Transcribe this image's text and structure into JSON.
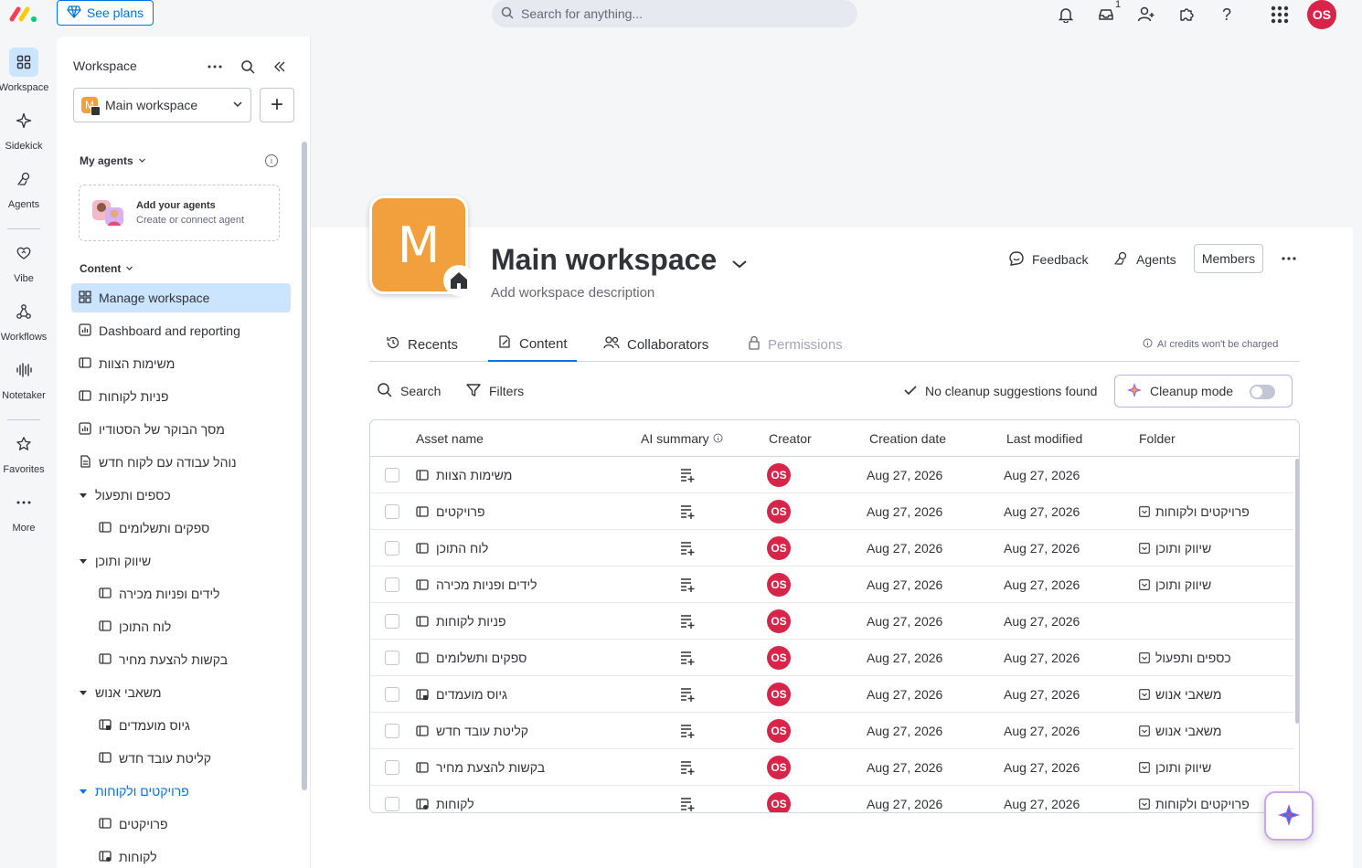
{
  "topbar": {
    "see_plans": "See plans",
    "search_placeholder": "Search for anything...",
    "inbox_count": "1",
    "user_initials": "OS"
  },
  "rail": {
    "workspace": "Workspace",
    "sidekick": "Sidekick",
    "agents": "Agents",
    "vibe": "Vibe",
    "workflows": "Workflows",
    "notetaker": "Notetaker",
    "favorites": "Favorites",
    "more": "More"
  },
  "sidebar": {
    "title": "Workspace",
    "workspace_select": "Main workspace",
    "my_agents_label": "My agents",
    "agent_card_title": "Add your agents",
    "agent_card_subtitle": "Create or connect agent",
    "content_label": "Content",
    "items": [
      {
        "label": "Manage workspace"
      },
      {
        "label": "Dashboard and reporting"
      },
      {
        "label": "משימות הצוות"
      },
      {
        "label": "פניות לקוחות"
      },
      {
        "label": "מסך הבוקר של הסטודיו"
      },
      {
        "label": "נוהל עבודה עם לקוח חדש"
      },
      {
        "label": "כספים ותפעול"
      },
      {
        "label": "ספקים ותשלומים"
      },
      {
        "label": "שיווק ותוכן"
      },
      {
        "label": "לידים ופניות מכירה"
      },
      {
        "label": "לוח התוכן"
      },
      {
        "label": "בקשות להצעת מחיר"
      },
      {
        "label": "משאבי אנוש"
      },
      {
        "label": "גיוס מועמדים"
      },
      {
        "label": "קליטת עובד חדש"
      },
      {
        "label": "פרויקטים ולקוחות"
      },
      {
        "label": "פרויקטים"
      },
      {
        "label": "לקוחות"
      }
    ]
  },
  "header": {
    "avatar_letter": "M",
    "title": "Main workspace",
    "description": "Add workspace description",
    "feedback": "Feedback",
    "agents": "Agents",
    "members": "Members"
  },
  "tabs": {
    "recents": "Recents",
    "content": "Content",
    "collaborators": "Collaborators",
    "permissions": "Permissions",
    "ai_note": "AI credits won't be charged"
  },
  "toolbar": {
    "search": "Search",
    "filters": "Filters",
    "cleanup_status": "No cleanup suggestions found",
    "cleanup_mode": "Cleanup mode"
  },
  "table": {
    "headers": {
      "asset": "Asset name",
      "ai_summary": "AI summary",
      "creator": "Creator",
      "created": "Creation date",
      "modified": "Last modified",
      "folder": "Folder"
    },
    "rows": [
      {
        "name": "משימות הצוות",
        "creator": "OS",
        "created": "Aug 27, 2026",
        "modified": "Aug 27, 2026",
        "folder": ""
      },
      {
        "name": "פרויקטים",
        "creator": "OS",
        "created": "Aug 27, 2026",
        "modified": "Aug 27, 2026",
        "folder": "פרויקטים ולקוחות"
      },
      {
        "name": "לוח התוכן",
        "creator": "OS",
        "created": "Aug 27, 2026",
        "modified": "Aug 27, 2026",
        "folder": "שיווק ותוכן"
      },
      {
        "name": "לידים ופניות מכירה",
        "creator": "OS",
        "created": "Aug 27, 2026",
        "modified": "Aug 27, 2026",
        "folder": "שיווק ותוכן"
      },
      {
        "name": "פניות לקוחות",
        "creator": "OS",
        "created": "Aug 27, 2026",
        "modified": "Aug 27, 2026",
        "folder": ""
      },
      {
        "name": "ספקים ותשלומים",
        "creator": "OS",
        "created": "Aug 27, 2026",
        "modified": "Aug 27, 2026",
        "folder": "כספים ותפעול"
      },
      {
        "name": "גיוס מועמדים",
        "creator": "OS",
        "created": "Aug 27, 2026",
        "modified": "Aug 27, 2026",
        "folder": "משאבי אנוש"
      },
      {
        "name": "קליטת עובד חדש",
        "creator": "OS",
        "created": "Aug 27, 2026",
        "modified": "Aug 27, 2026",
        "folder": "משאבי אנוש"
      },
      {
        "name": "בקשות להצעת מחיר",
        "creator": "OS",
        "created": "Aug 27, 2026",
        "modified": "Aug 27, 2026",
        "folder": "שיווק ותוכן"
      },
      {
        "name": "לקוחות",
        "creator": "OS",
        "created": "Aug 27, 2026",
        "modified": "Aug 27, 2026",
        "folder": "פרויקטים ולקוחות"
      }
    ]
  }
}
